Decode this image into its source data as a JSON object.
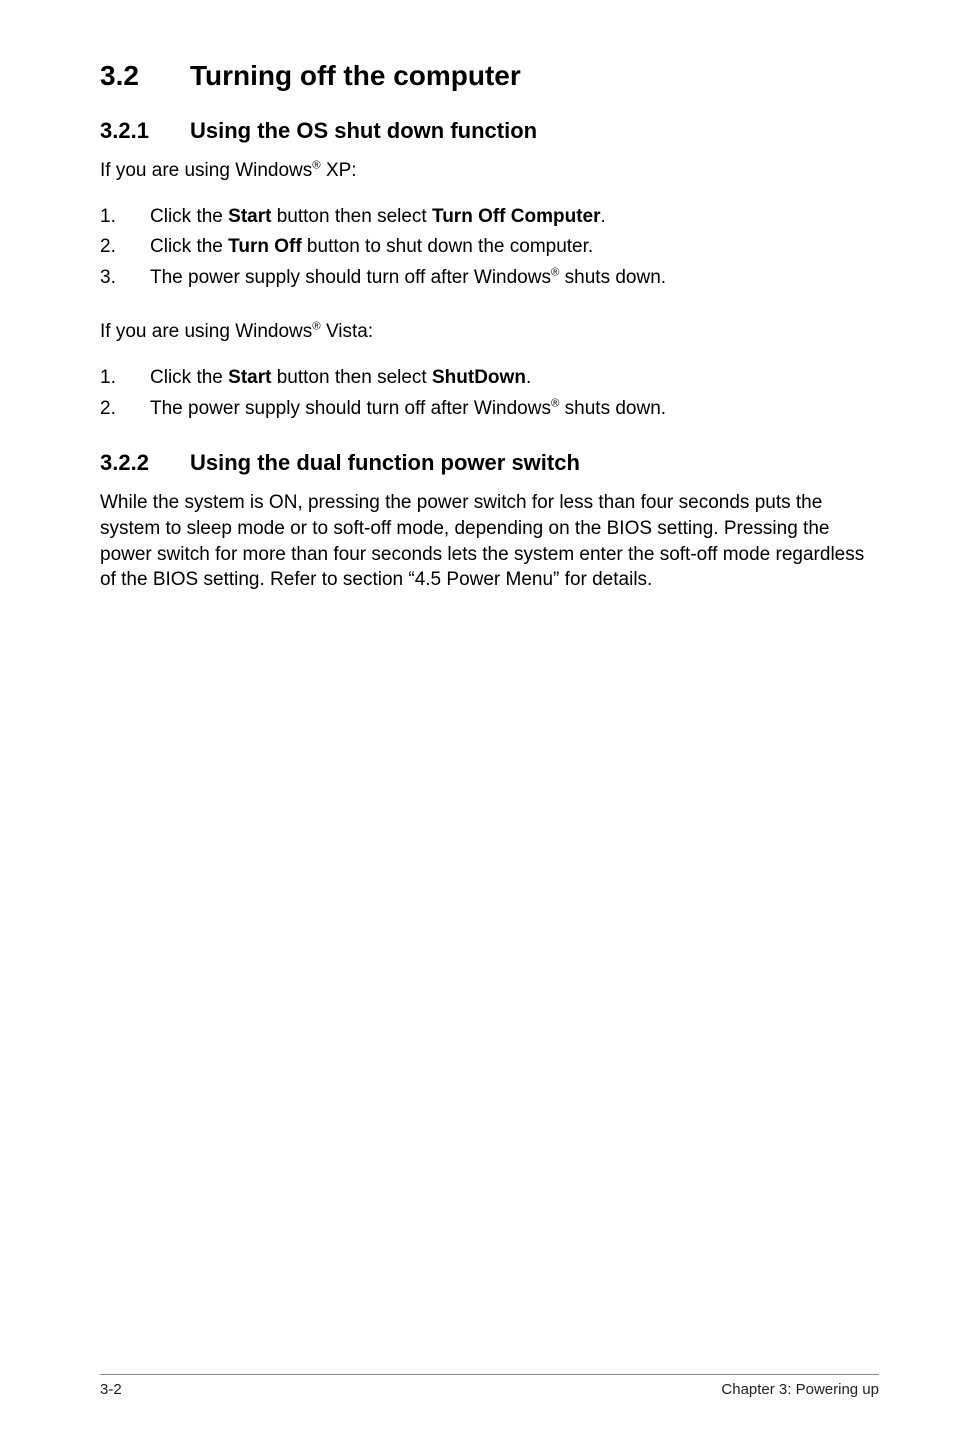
{
  "heading": {
    "number": "3.2",
    "title": "Turning off the computer"
  },
  "section1": {
    "number": "3.2.1",
    "title": "Using the OS shut down function",
    "intro_xp_pre": "If you are using Windows",
    "intro_xp_post": " XP:",
    "steps_xp": [
      {
        "n": "1.",
        "pre": "Click the ",
        "b1": "Start",
        "mid": " button then select ",
        "b2": "Turn Off Computer",
        "post": "."
      },
      {
        "n": "2.",
        "pre": "Click the ",
        "b1": "Turn Off",
        "mid": " button to shut down the computer.",
        "b2": "",
        "post": ""
      },
      {
        "n": "3.",
        "pre": "The power supply should turn off after Windows",
        "sup": "®",
        "post": " shuts down."
      }
    ],
    "intro_vista_pre": "If you are using Windows",
    "intro_vista_post": " Vista:",
    "steps_vista": [
      {
        "n": "1.",
        "pre": "Click the ",
        "b1": "Start",
        "mid": " button then select ",
        "b2": "ShutDown",
        "post": "."
      },
      {
        "n": "2.",
        "pre": "The power supply should turn off after Windows",
        "sup": "®",
        "post": " shuts down."
      }
    ]
  },
  "section2": {
    "number": "3.2.2",
    "title": "Using the dual function power switch",
    "body": "While the system is ON, pressing the power switch for less than four seconds puts the system to sleep mode or to soft-off mode, depending on the BIOS setting. Pressing the power switch for more than four seconds lets the system enter the soft-off mode regardless of the BIOS setting. Refer to section  “4.5 Power Menu” for details."
  },
  "footer": {
    "left": "3-2",
    "right": "Chapter 3: Powering up"
  }
}
